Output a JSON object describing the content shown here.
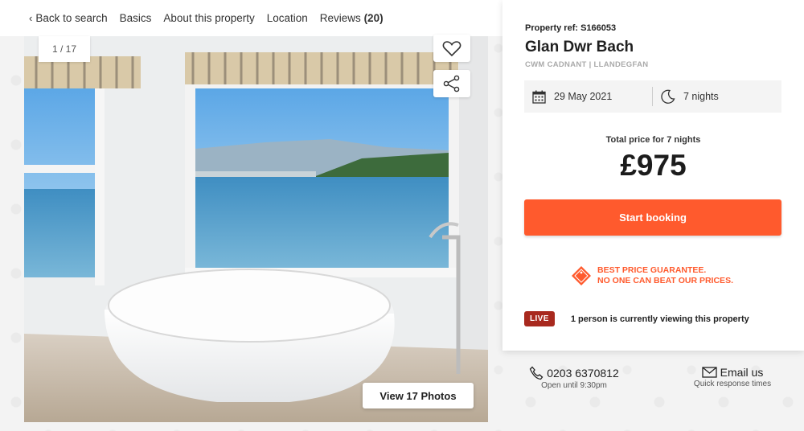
{
  "nav": {
    "back_label": "Back to search",
    "basics": "Basics",
    "about": "About this property",
    "location": "Location",
    "reviews_label": "Reviews",
    "reviews_count": "(20)"
  },
  "gallery": {
    "counter": "1 / 17",
    "view_photos": "View 17 Photos",
    "favorite_icon": "heart-icon",
    "share_icon": "share-icon"
  },
  "booking": {
    "property_ref": "Property ref: S166053",
    "title": "Glan Dwr Bach",
    "location": "CWM CADNANT | LLANDEGFAN",
    "date": "29 May 2021",
    "nights": "7 nights",
    "total_label": "Total price for 7 nights",
    "price": "£975",
    "cta": "Start booking",
    "guarantee_line1": "BEST PRICE GUARANTEE.",
    "guarantee_line2": "NO ONE CAN BEAT OUR PRICES.",
    "live_badge": "LIVE",
    "live_text": "1 person is currently viewing this property",
    "accent_color": "#ff5a2d"
  },
  "contact": {
    "phone": "0203 6370812",
    "phone_hours": "Open until 9:30pm",
    "email_label": "Email us",
    "email_sub": "Quick response times"
  }
}
